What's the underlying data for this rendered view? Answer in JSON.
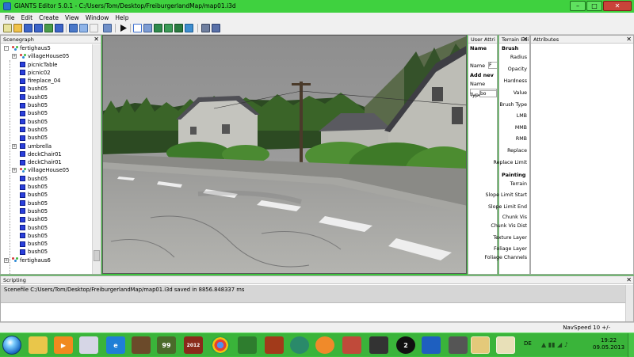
{
  "window": {
    "title": "GIANTS Editor 5.0.1 - C:/Users/Tom/Desktop/FreiburgerlandMap/map01.i3d",
    "min_glyph": "–",
    "max_glyph": "□",
    "close_glyph": "✕"
  },
  "menu": [
    "File",
    "Edit",
    "Create",
    "View",
    "Window",
    "Help"
  ],
  "toolbar_icons": [
    "new-icon",
    "open-icon",
    "save-icon",
    "save-all-icon",
    "export-icon",
    "import-icon",
    "undo-icon",
    "redo-icon",
    "play-icon",
    "select-icon",
    "move-icon",
    "terrain-paint-icon",
    "terrain-sculpt-icon",
    "foliage-icon",
    "grass-icon",
    "snap-icon",
    "camera-icon"
  ],
  "panels": {
    "scenegraph": {
      "title": "Scenegraph"
    },
    "user_attributes": {
      "title": "User Attri"
    },
    "terrain_editor": {
      "title": "Terrain Edi"
    },
    "attributes": {
      "title": "Attributes"
    },
    "scripting": {
      "title": "Scripting"
    }
  },
  "scenegraph": {
    "nodes": [
      {
        "label": "fertighaus5",
        "indent": 0,
        "icon": "transformgroup-icon",
        "expander": "-"
      },
      {
        "label": "villageHouse05",
        "indent": 1,
        "icon": "transformgroup-icon",
        "expander": "+"
      },
      {
        "label": "picnicTable",
        "indent": 1,
        "icon": "cube-icon",
        "expander": ""
      },
      {
        "label": "picnic02",
        "indent": 1,
        "icon": "cube-icon",
        "expander": ""
      },
      {
        "label": "fireplace_04",
        "indent": 1,
        "icon": "cube-icon",
        "expander": ""
      },
      {
        "label": "bush05",
        "indent": 1,
        "icon": "cube-icon",
        "expander": ""
      },
      {
        "label": "bush05",
        "indent": 1,
        "icon": "cube-icon",
        "expander": ""
      },
      {
        "label": "bush05",
        "indent": 1,
        "icon": "cube-icon",
        "expander": ""
      },
      {
        "label": "bush05",
        "indent": 1,
        "icon": "cube-icon",
        "expander": ""
      },
      {
        "label": "bush05",
        "indent": 1,
        "icon": "cube-icon",
        "expander": ""
      },
      {
        "label": "bush05",
        "indent": 1,
        "icon": "cube-icon",
        "expander": ""
      },
      {
        "label": "bush05",
        "indent": 1,
        "icon": "cube-icon",
        "expander": ""
      },
      {
        "label": "umbrella",
        "indent": 1,
        "icon": "cube-icon",
        "expander": "+"
      },
      {
        "label": "deckChair01",
        "indent": 1,
        "icon": "cube-icon",
        "expander": ""
      },
      {
        "label": "deckChair01",
        "indent": 1,
        "icon": "cube-icon",
        "expander": ""
      },
      {
        "label": "villageHouse05",
        "indent": 1,
        "icon": "transformgroup-icon",
        "expander": "+"
      },
      {
        "label": "bush05",
        "indent": 1,
        "icon": "cube-icon",
        "expander": ""
      },
      {
        "label": "bush05",
        "indent": 1,
        "icon": "cube-icon",
        "expander": ""
      },
      {
        "label": "bush05",
        "indent": 1,
        "icon": "cube-icon",
        "expander": ""
      },
      {
        "label": "bush05",
        "indent": 1,
        "icon": "cube-icon",
        "expander": ""
      },
      {
        "label": "bush05",
        "indent": 1,
        "icon": "cube-icon",
        "expander": ""
      },
      {
        "label": "bush05",
        "indent": 1,
        "icon": "cube-icon",
        "expander": ""
      },
      {
        "label": "bush05",
        "indent": 1,
        "icon": "cube-icon",
        "expander": ""
      },
      {
        "label": "bush05",
        "indent": 1,
        "icon": "cube-icon",
        "expander": ""
      },
      {
        "label": "bush05",
        "indent": 1,
        "icon": "cube-icon",
        "expander": ""
      },
      {
        "label": "bush05",
        "indent": 1,
        "icon": "cube-icon",
        "expander": ""
      },
      {
        "label": "fertighaus6",
        "indent": 0,
        "icon": "transformgroup-icon",
        "expander": "+"
      }
    ]
  },
  "user_attributes": {
    "name_header": "Name",
    "name_label": "Name",
    "name_value": "F",
    "add_header": "Add nev",
    "add_name_label": "Name",
    "type_label": "Type",
    "type_value": "bo"
  },
  "terrain_editor": {
    "brush_header": "Brush",
    "brush_fields": [
      "Radius",
      "Opacity",
      "Hardness",
      "Value",
      "Brush Type",
      "LMB",
      "MMB",
      "RMB",
      "Replace",
      "Replace Limit"
    ],
    "painting_header": "Painting",
    "painting_fields": [
      "Terrain",
      "Slope Limit Start",
      "Slope Limit End",
      "Chunk Vis",
      "Chunk Vis Dist",
      "Texture Layer",
      "Foliage Layer",
      "Foliage Channels"
    ]
  },
  "scripting": {
    "output": "Scenefile C:/Users/Tom/Desktop/FreiburgerlandMap/map01.i3d saved in 8856.848337 ms"
  },
  "statusbar": {
    "navspeed": "NavSpeed 10 +/-"
  },
  "taskbar": {
    "apps": [
      "explorer-icon",
      "media-player-icon",
      "paint-icon",
      "internet-explorer-icon",
      "minecraft-icon",
      "farming-simulator-icon",
      "farming-simulator-2012-icon",
      "chrome-icon",
      "tractor-icon",
      "fs-mod-icon",
      "app-icon",
      "blender-icon",
      "tool-icon",
      "game-icon",
      "ea-icon",
      "skype-icon",
      "app2-icon",
      "folder-icon",
      "giants-editor-icon"
    ],
    "badge_99": "99",
    "badge_2012": "2012",
    "badge_2": "2",
    "language": "DE",
    "time": "19:22",
    "date": "09.05.2013"
  }
}
